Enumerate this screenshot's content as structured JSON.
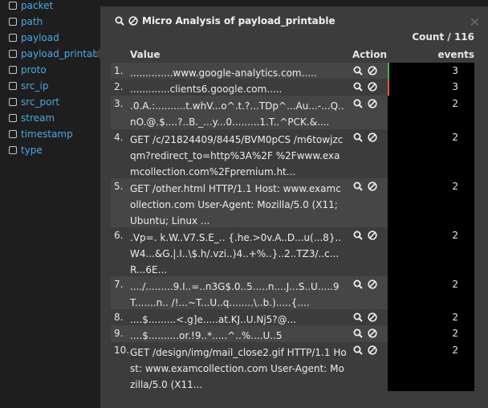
{
  "sidebar": {
    "fields": [
      "packet",
      "path",
      "payload",
      "payload_printabl",
      "proto",
      "src_ip",
      "src_port",
      "stream",
      "timestamp",
      "type"
    ]
  },
  "panel": {
    "title": "Micro Analysis of payload_printable",
    "count_label": "Count / 116",
    "headers": {
      "value": "Value",
      "action": "Action",
      "events": "events"
    }
  },
  "rows": [
    {
      "num": "1.",
      "value": "..............www.google-analytics.com.....",
      "events": "3",
      "bar_color": "#48b048"
    },
    {
      "num": "2.",
      "value": ".............clients6.google.com.....",
      "events": "3",
      "bar_color": "#e65a2c"
    },
    {
      "num": "3.",
      "value": ".0.A.:..........t.whV...o^.t.?...TDp^...Au...-...Q..nO.@.$....?..B._...y...0.........1.T..^PCK.&....",
      "events": "2",
      "bar_color": "#000000"
    },
    {
      "num": "4.",
      "value": "GET /c/21824409/8445/BVM0pCS /m6towjzcqm?redirect_to=http%3A%2F %2Fwww.examcollection.com%2Fpremium.ht...",
      "events": "2",
      "bar_color": "#000000"
    },
    {
      "num": "5.",
      "value": "GET /other.html HTTP/1.1 Host: www.examcollection.com User-Agent: Mozilla/5.0 (X11; Ubuntu; Linux ...",
      "events": "2",
      "bar_color": "#000000"
    },
    {
      "num": "6.",
      "value": ".Vp=. k.W..V7.S.E_.. {.he.>0v.A..D...u(...8}..W4...&G.|.I..\\$.h/.vzi..)4..+%..}..2..TZ3/..c...R...6E...",
      "events": "2",
      "bar_color": "#000000"
    },
    {
      "num": "7.",
      "value": "..../.........9.I..=..n3G$.0..5.....n....J...S..U.....9T.......n.. /!...~T...U..q........\\..b.).....{....",
      "events": "2",
      "bar_color": "#000000"
    },
    {
      "num": "8.",
      "value": "....$.........<.g]e.....at.KJ..U.Nj5?@...",
      "events": "2",
      "bar_color": "#000000"
    },
    {
      "num": "9.",
      "value": "....$..........or.!9..*.....^..%....U..5",
      "events": "2",
      "bar_color": "#000000"
    },
    {
      "num": "10.",
      "value": "GET /design/img/mail_close2.gif HTTP/1.1 Host: www.examcollection.com User-Agent: Mozilla/5.0 (X11...",
      "events": "2",
      "bar_color": "#000000"
    }
  ]
}
